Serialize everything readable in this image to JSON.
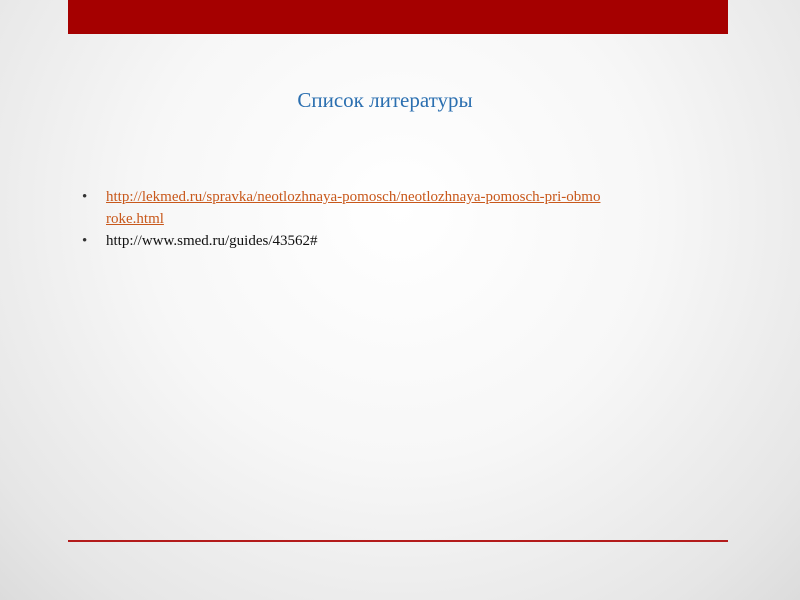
{
  "slide": {
    "title": "Список литературы",
    "references": [
      {
        "text": "http://lekmed.ru/spravka/neotlozhnaya-pomosch/neotlozhnaya-pomosch-pri-obmoroke.html",
        "is_link": true
      },
      {
        "text": "http://www.smed.ru/guides/43562#",
        "is_link": false
      }
    ],
    "bullet_symbol": "•"
  },
  "colors": {
    "top_bar": "#a50000",
    "title": "#2b6fb0",
    "link": "#c8581b",
    "bottom_line": "#b31b1b"
  }
}
